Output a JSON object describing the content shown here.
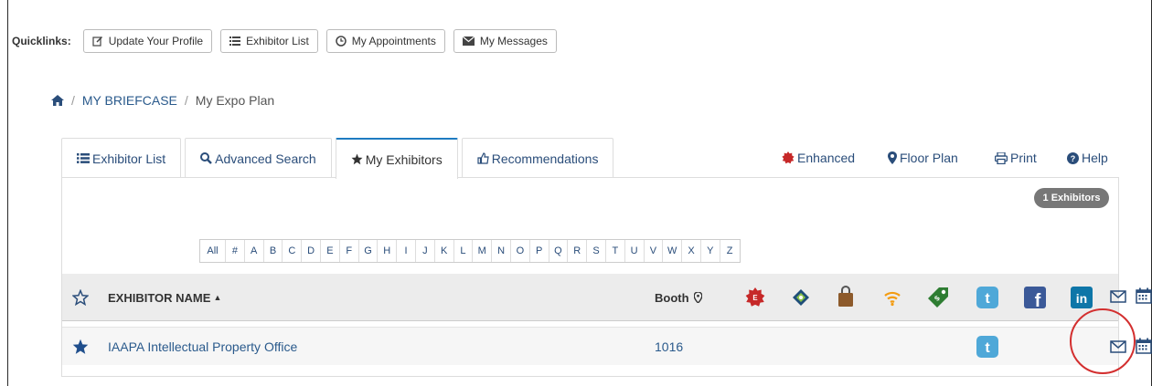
{
  "quicklinks": {
    "label": "Quicklinks:",
    "buttons": [
      {
        "label": "Update Your Profile",
        "icon": "edit-icon"
      },
      {
        "label": "Exhibitor List",
        "icon": "list-icon"
      },
      {
        "label": "My Appointments",
        "icon": "clock-icon"
      },
      {
        "label": "My Messages",
        "icon": "envelope-icon"
      }
    ]
  },
  "breadcrumb": {
    "items": [
      "MY BRIEFCASE",
      "My Expo Plan"
    ],
    "separator": "/"
  },
  "tabs": [
    {
      "label": "Exhibitor List",
      "icon": "list-icon",
      "active": false
    },
    {
      "label": "Advanced Search",
      "icon": "search-icon",
      "active": false
    },
    {
      "label": "My Exhibitors",
      "icon": "star-icon",
      "active": true
    },
    {
      "label": "Recommendations",
      "icon": "thumbs-up-icon",
      "active": false
    }
  ],
  "toplinks": [
    {
      "label": "Enhanced",
      "icon": "enhanced-badge-icon"
    },
    {
      "label": "Floor Plan",
      "icon": "map-marker-icon"
    },
    {
      "label": "Print",
      "icon": "print-icon"
    },
    {
      "label": "Help",
      "icon": "question-circle-icon"
    }
  ],
  "count_badge": "1 Exhibitors",
  "alphabet": [
    "All",
    "#",
    "A",
    "B",
    "C",
    "D",
    "E",
    "F",
    "G",
    "H",
    "I",
    "J",
    "K",
    "L",
    "M",
    "N",
    "O",
    "P",
    "Q",
    "R",
    "S",
    "T",
    "U",
    "V",
    "W",
    "X",
    "Y",
    "Z"
  ],
  "table": {
    "headers": {
      "name": "EXHIBITOR NAME",
      "sort_indicator": "▲",
      "booth": "Booth"
    },
    "column_icons": [
      "enhanced-badge-icon",
      "diamond-tag-icon",
      "shopping-bag-icon",
      "wifi-icon",
      "price-tag-icon",
      "twitter-icon",
      "facebook-icon",
      "linkedin-icon",
      "envelope-icon",
      "calendar-icon"
    ],
    "rows": [
      {
        "name": "IAAPA Intellectual Property Office",
        "booth": "1016",
        "starred": true,
        "has_twitter": true,
        "has_message": true,
        "has_calendar": true
      }
    ]
  },
  "colors": {
    "link": "#2a5a8c",
    "active_tab_border": "#1e7bc1",
    "badge_bg": "#777777",
    "highlight_circle": "#d32f2f",
    "enhanced_red": "#c62828",
    "twitter_blue": "#4fa8d8",
    "facebook_blue": "#3b5998",
    "linkedin_blue": "#0e76a8"
  }
}
